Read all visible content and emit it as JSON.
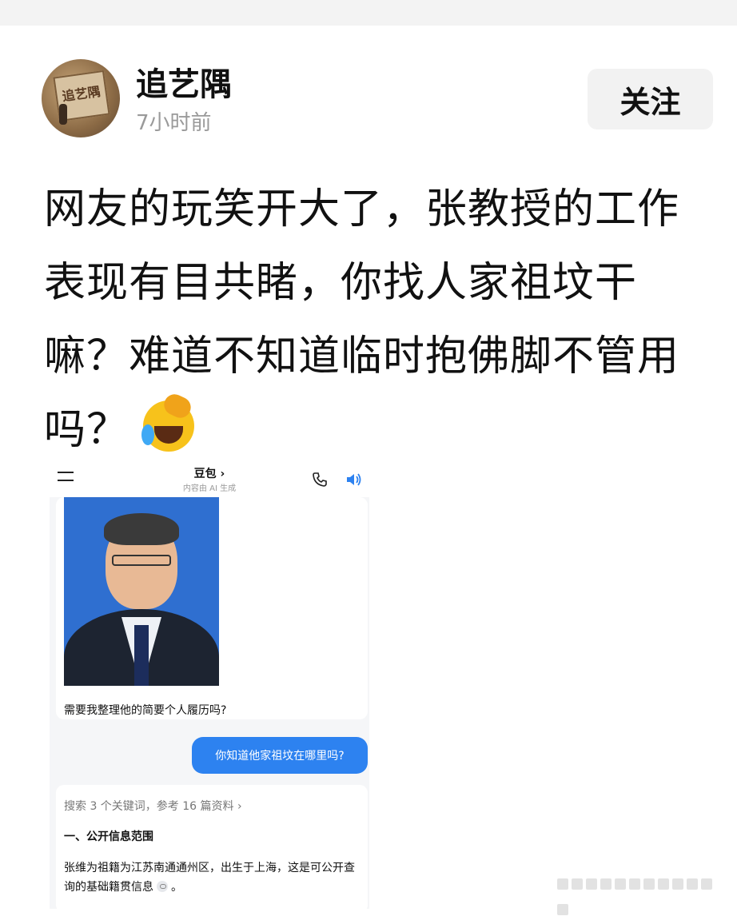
{
  "author": {
    "name": "追艺隅",
    "time": "7小时前",
    "follow_label": "关注",
    "avatar_text": "追艺隅"
  },
  "post": {
    "line1": "网友的玩笑开大了，张教授的工作",
    "line2": "表现有目共睹，你找人家祖坟干",
    "line3": "嘛？难道不知道临时抱佛脚不管用",
    "line4": "吗？",
    "emoji": "laughing-tears-emoji"
  },
  "embedded": {
    "title": "豆包 ›",
    "subtitle": "内容由 AI 生成",
    "card_text": "需要我整理他的简要个人履历吗?",
    "user_message": "你知道他家祖坟在哪里吗?",
    "search_line": "搜索 3 个关键词，参考 16 篇资料 ›",
    "section_title": "一、公开信息范围",
    "body_part1": "张维为祖籍为江苏南通通州区，出生于上海，这是可公开查询的基础籍贯信息",
    "body_part2": "。",
    "accent_color": "#2d82f0"
  }
}
